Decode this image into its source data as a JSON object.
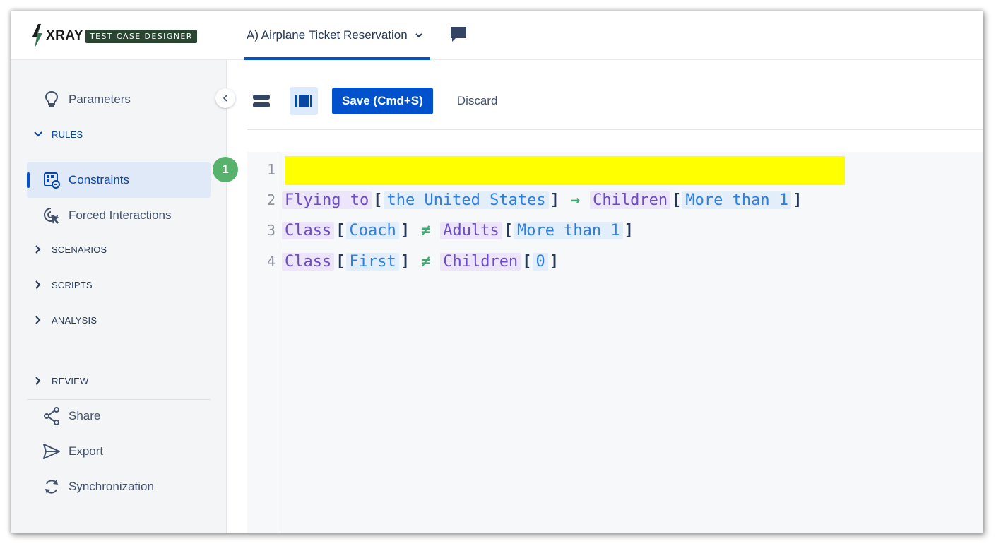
{
  "header": {
    "logo_text": "XRAY",
    "logo_subtitle": "TEST CASE DESIGNER",
    "project_title": "A) Airplane Ticket Reservation"
  },
  "sidebar": {
    "parameters_label": "Parameters",
    "rules_section": "RULES",
    "constraints_label": "Constraints",
    "constraints_badge": "1",
    "forced_interactions_label": "Forced Interactions",
    "scenarios_section": "SCENARIOS",
    "scripts_section": "SCRIPTS",
    "analysis_section": "ANALYSIS",
    "review_section": "REVIEW",
    "share_label": "Share",
    "export_label": "Export",
    "synchronization_label": "Synchronization"
  },
  "toolbar": {
    "save_label": "Save (Cmd+S)",
    "discard_label": "Discard"
  },
  "editor": {
    "line_numbers": [
      "1",
      "2",
      "3",
      "4"
    ],
    "lines": [
      {
        "highlighted": true
      },
      {
        "left_param": "Flying to",
        "left_value": "the United States",
        "operator": "→",
        "right_param": "Children",
        "right_value": "More than 1"
      },
      {
        "left_param": "Class",
        "left_value": "Coach",
        "operator": "≠",
        "right_param": "Adults",
        "right_value": "More than 1"
      },
      {
        "left_param": "Class",
        "left_value": "First",
        "operator": "≠",
        "right_param": "Children",
        "right_value": "0"
      }
    ]
  },
  "colors": {
    "primary": "#0052cc",
    "active_bg": "#dfe9f8",
    "badge": "#57b36b",
    "highlight": "#ffff00",
    "param_text": "#6d4cc4",
    "value_text": "#2f7fe0",
    "operator": "#3dab6f"
  },
  "icons": {
    "parameters": "lightbulb-icon",
    "constraints": "constraints-grid-icon",
    "forced_interactions": "cursor-click-icon",
    "share": "share-icon",
    "export": "send-icon",
    "synchronization": "sync-icon",
    "chat": "chat-icon"
  }
}
